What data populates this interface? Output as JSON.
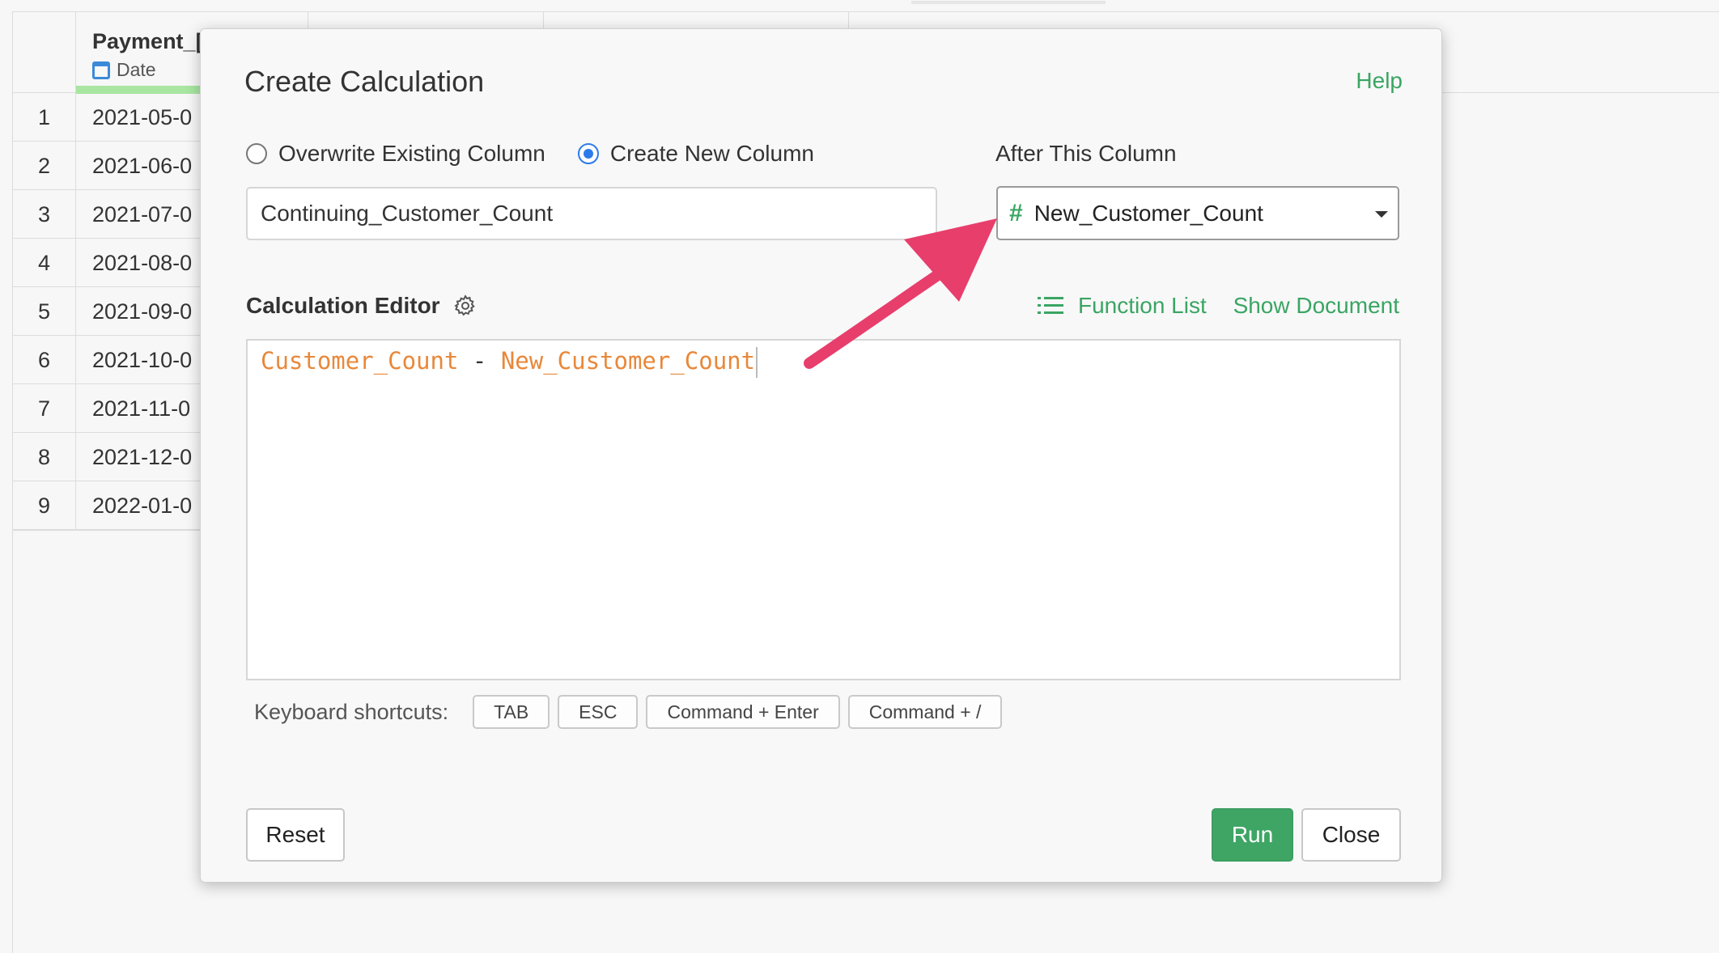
{
  "table": {
    "column_name": "Payment_[",
    "column_type": "Date",
    "rows": [
      {
        "num": "1",
        "value": "2021-05-0"
      },
      {
        "num": "2",
        "value": "2021-06-0"
      },
      {
        "num": "3",
        "value": "2021-07-0"
      },
      {
        "num": "4",
        "value": "2021-08-0"
      },
      {
        "num": "5",
        "value": "2021-09-0"
      },
      {
        "num": "6",
        "value": "2021-10-0"
      },
      {
        "num": "7",
        "value": "2021-11-0"
      },
      {
        "num": "8",
        "value": "2021-12-0"
      },
      {
        "num": "9",
        "value": "2022-01-0"
      }
    ]
  },
  "dialog": {
    "title": "Create Calculation",
    "help_label": "Help",
    "radio_overwrite": "Overwrite Existing Column",
    "radio_create": "Create New Column",
    "selected_radio": "create",
    "new_column_name": "Continuing_Customer_Count",
    "after_column_label": "After This Column",
    "after_column_value": "New_Customer_Count",
    "editor_label": "Calculation Editor",
    "function_list_label": "Function List",
    "show_document_label": "Show Document",
    "expression": {
      "left": "Customer_Count",
      "operator": " - ",
      "right": "New_Customer_Count"
    },
    "shortcuts_label": "Keyboard shortcuts:",
    "shortcuts": [
      "TAB",
      "ESC",
      "Command + Enter",
      "Command + /"
    ],
    "reset_label": "Reset",
    "run_label": "Run",
    "close_label": "Close"
  },
  "colors": {
    "accent_green": "#3aa563",
    "code_identifier": "#e8883a",
    "radio_blue": "#2d7bea",
    "annotation_arrow": "#e83e6c"
  }
}
